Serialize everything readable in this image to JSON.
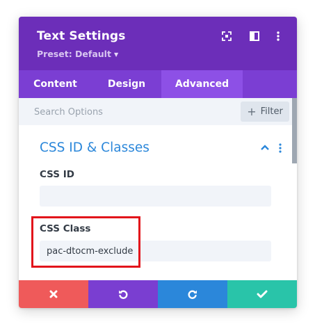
{
  "modal": {
    "title": "Text Settings",
    "preset_label": "Preset: Default",
    "header_icons": [
      "fullscreen-icon",
      "split-view-icon",
      "more-options-icon"
    ]
  },
  "tabs": [
    {
      "label": "Content",
      "active": false
    },
    {
      "label": "Design",
      "active": false
    },
    {
      "label": "Advanced",
      "active": true
    }
  ],
  "search": {
    "placeholder": "Search Options",
    "value": "",
    "filter_label": "Filter"
  },
  "section": {
    "title": "CSS ID & Classes",
    "expanded": true,
    "fields": [
      {
        "label": "CSS ID",
        "value": ""
      },
      {
        "label": "CSS Class",
        "value": "pac-dtocm-exclude",
        "highlighted": true
      }
    ]
  },
  "footer": {
    "buttons": [
      "close-icon",
      "undo-icon",
      "redo-icon",
      "checkmark-icon"
    ]
  },
  "colors": {
    "header": "#6c2eb9",
    "tabs": "#7b3ed3",
    "active_tab": "#8d50e6",
    "accent_blue": "#2b87da",
    "highlight": "#e2141b",
    "close": "#ef5a5a",
    "undo": "#7a3ed1",
    "redo": "#2b87da",
    "save": "#29c4a9"
  }
}
